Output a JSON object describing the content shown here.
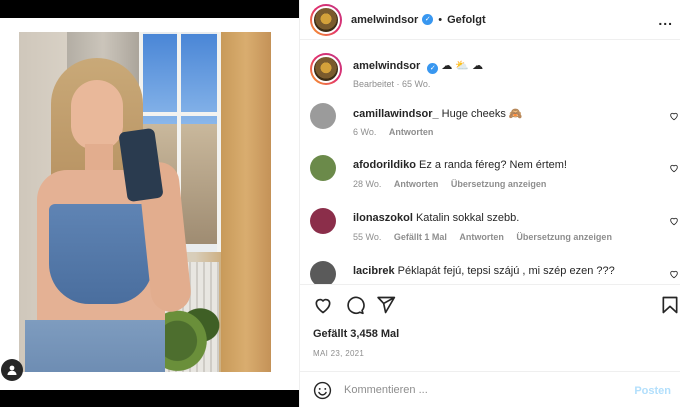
{
  "header": {
    "username": "amelwindsor",
    "separator": "•",
    "follow_status": "Gefolgt",
    "more": "..."
  },
  "caption": {
    "username": "amelwindsor",
    "text": "☁ ⛅ ☁",
    "meta": "Bearbeitet · 65 Wo."
  },
  "comments": [
    {
      "username": "camillawindsor_",
      "text": "Huge cheeks 🙈",
      "age": "6 Wo.",
      "likes": "",
      "reply": "Antworten",
      "translate": "",
      "avatar_color": "#9b9b9b"
    },
    {
      "username": "afodorildiko",
      "text": "Ez a randa féreg? Nem értem!",
      "age": "28 Wo.",
      "likes": "",
      "reply": "Antworten",
      "translate": "Übersetzung anzeigen",
      "avatar_color": "#6b8a4a"
    },
    {
      "username": "ilonaszokol",
      "text": "Katalin sokkal szebb.",
      "age": "55 Wo.",
      "likes": "Gefällt 1 Mal",
      "reply": "Antworten",
      "translate": "Übersetzung anzeigen",
      "avatar_color": "#8b2e4a"
    },
    {
      "username": "lacibrek",
      "text": "Péklapát fejú, tepsi szájú , mi szép ezen ???",
      "age": "",
      "likes": "",
      "reply": "",
      "translate": "",
      "avatar_color": "#5a5a5a"
    }
  ],
  "likes": "Gefällt 3,458 Mal",
  "date": "MAI 23, 2021",
  "composer": {
    "placeholder": "Kommentieren ...",
    "post_label": "Posten"
  },
  "colors": {
    "verified": "#3897f0",
    "post_disabled": "#b2dffc",
    "meta_gray": "#8e8e8e"
  }
}
